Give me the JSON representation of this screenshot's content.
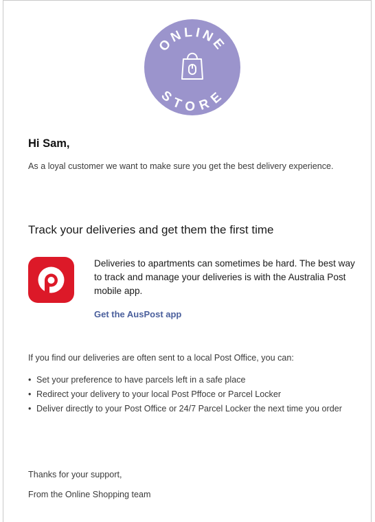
{
  "logo": {
    "top_text": "ONLINE",
    "bottom_text": "STORE",
    "circle_color": "#9b94cc",
    "icon": "shopping-bag-icon"
  },
  "email": {
    "greeting": "Hi Sam,",
    "intro": "As a loyal customer we want to make sure you get the best delivery experience.",
    "section_title": "Track your deliveries and get them the first time",
    "app": {
      "icon": "australia-post-logo-icon",
      "icon_color": "#dc1928",
      "description": "Deliveries to apartments can sometimes be hard. The best way to track and manage your deliveries is with the Australia Post mobile app.",
      "link_label": "Get the AusPost app",
      "link_color": "#4a5f9c"
    },
    "post_office_intro": "If you find our deliveries are often sent to a local Post Office, you can:",
    "options": [
      "Set your preference to have parcels left in a safe place",
      "Redirect your delivery to your local Post Pffoce or Parcel Locker",
      "Deliver directly to your Post Office or 24/7 Parcel Locker the next time you order"
    ],
    "thanks": "Thanks for your support,",
    "signoff": "From the Online Shopping team"
  }
}
